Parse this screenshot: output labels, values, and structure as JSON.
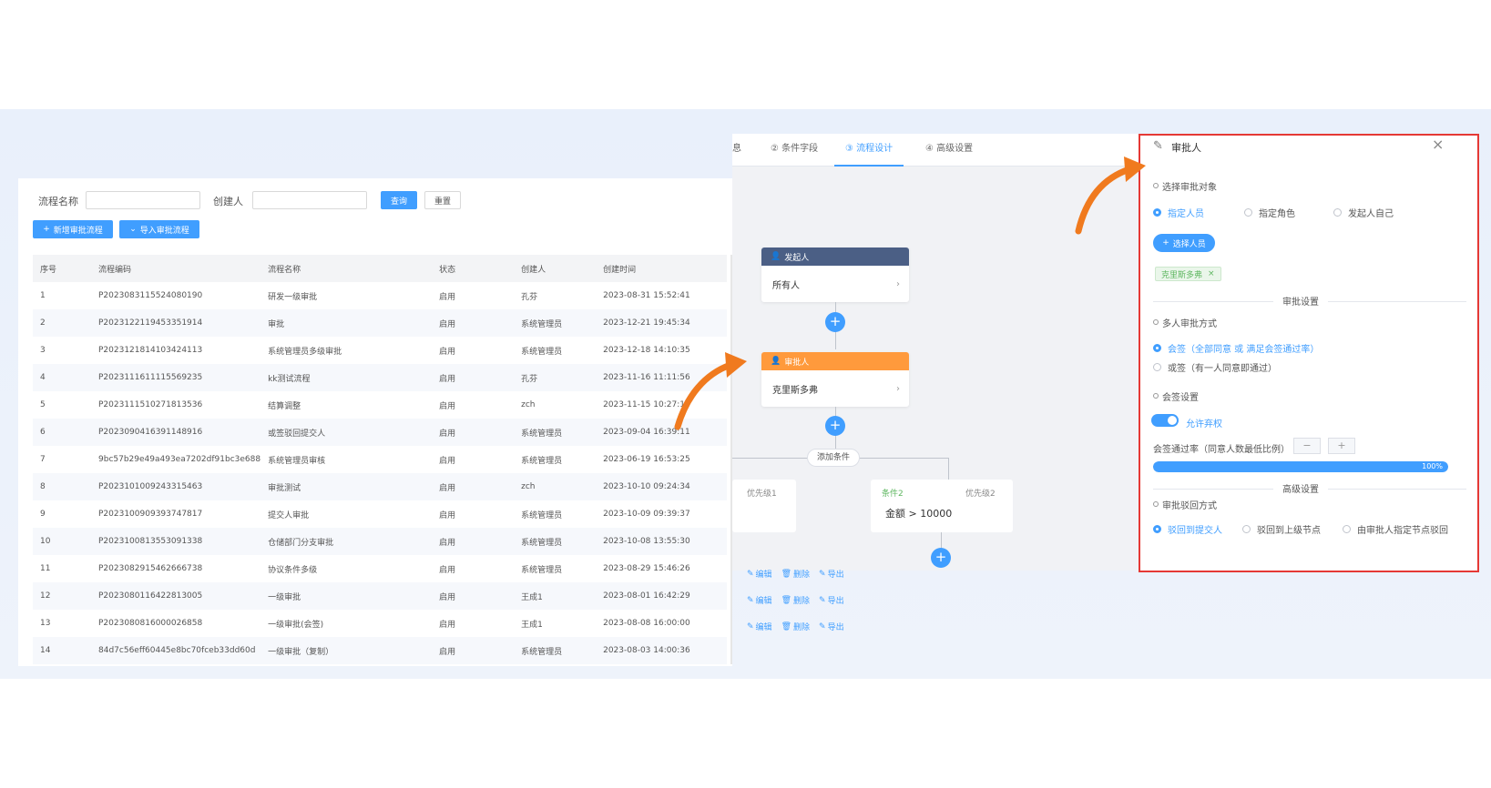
{
  "search": {
    "name_label": "流程名称",
    "creator_label": "创建人",
    "query_label": "查询",
    "reset_label": "重置"
  },
  "toolbar": {
    "add_label": "新增审批流程",
    "import_label": "导入审批流程"
  },
  "table": {
    "headers": [
      "序号",
      "流程编码",
      "流程名称",
      "状态",
      "创建人",
      "创建时间"
    ],
    "rows": [
      [
        "1",
        "P2023083115524080190",
        "研发一级审批",
        "启用",
        "孔芬",
        "2023-08-31 15:52:41"
      ],
      [
        "2",
        "P2023122119453351914",
        "审批",
        "启用",
        "系统管理员",
        "2023-12-21 19:45:34"
      ],
      [
        "3",
        "P2023121814103424113",
        "系统管理员多级审批",
        "启用",
        "系统管理员",
        "2023-12-18 14:10:35"
      ],
      [
        "4",
        "P2023111611115569235",
        "kk测试流程",
        "启用",
        "孔芬",
        "2023-11-16 11:11:56"
      ],
      [
        "5",
        "P2023111510271813536",
        "结算调整",
        "启用",
        "zch",
        "2023-11-15 10:27:19"
      ],
      [
        "6",
        "P2023090416391148916",
        "或签驳回提交人",
        "启用",
        "系统管理员",
        "2023-09-04 16:39:11"
      ],
      [
        "7",
        "9bc57b29e49a493ea7202df91bc3e688",
        "系统管理员审核",
        "启用",
        "系统管理员",
        "2023-06-19 16:53:25"
      ],
      [
        "8",
        "P2023101009243315463",
        "审批测试",
        "启用",
        "zch",
        "2023-10-10 09:24:34"
      ],
      [
        "9",
        "P2023100909393747817",
        "提交人审批",
        "启用",
        "系统管理员",
        "2023-10-09 09:39:37"
      ],
      [
        "10",
        "P2023100813553091338",
        "仓储部门分支审批",
        "启用",
        "系统管理员",
        "2023-10-08 13:55:30"
      ],
      [
        "11",
        "P2023082915462666738",
        "协议条件多级",
        "启用",
        "系统管理员",
        "2023-08-29 15:46:26"
      ],
      [
        "12",
        "P2023080116422813005",
        "一级审批",
        "启用",
        "王成1",
        "2023-08-01 16:42:29"
      ],
      [
        "13",
        "P2023080816000026858",
        "一级审批(会签)",
        "启用",
        "王成1",
        "2023-08-08 16:00:00"
      ],
      [
        "14",
        "84d7c56eff60445e8bc70fceb33dd60d",
        "一级审批（复制）",
        "启用",
        "系统管理员",
        "2023-08-03 14:00:36"
      ]
    ],
    "actions": {
      "edit": "编辑",
      "delete": "删除",
      "export": "导出"
    }
  },
  "designer": {
    "tabs": [
      "息",
      "② 条件字段",
      "③ 流程设计",
      "④ 高级设置"
    ],
    "initiator_title": "发起人",
    "initiator_value": "所有人",
    "approver_title": "审批人",
    "approver_value": "克里斯多弗",
    "add_condition": "添加条件",
    "priority1": "优先级1",
    "condition2": "条件2",
    "priority2": "优先级2",
    "condition2_expr": "金额 > 10000"
  },
  "drawer": {
    "title": "审批人",
    "select_target": "选择审批对象",
    "opt_user": "指定人员",
    "opt_role": "指定角色",
    "opt_self": "发起人自己",
    "select_user_btn": "选择人员",
    "selected_tag": "克里斯多弗",
    "section_approval": "审批设置",
    "multi_method": "多人审批方式",
    "countersign": "会签（全部同意 或 满足会签通过率）",
    "or_sign": "或签（有一人同意即通过）",
    "countersign_settings": "会签设置",
    "allow_abstain": "允许弃权",
    "pass_rate_label": "会签通过率（同意人数最低比例）",
    "pass_rate_value": "100%",
    "pass_rate_fraction": 1.0,
    "section_advanced": "高级设置",
    "reject_method": "审批驳回方式",
    "reject_to_submitter": "驳回到提交人",
    "reject_to_parent": "驳回到上级节点",
    "reject_by_approver": "由审批人指定节点驳回"
  },
  "colors": {
    "primary": "#409eff",
    "initiator_header": "#4b5f85",
    "approver_header": "#ff9a3c",
    "arrow": "#f07a1e",
    "drawer_border": "#e53935",
    "tag_green": "#5fb761"
  }
}
